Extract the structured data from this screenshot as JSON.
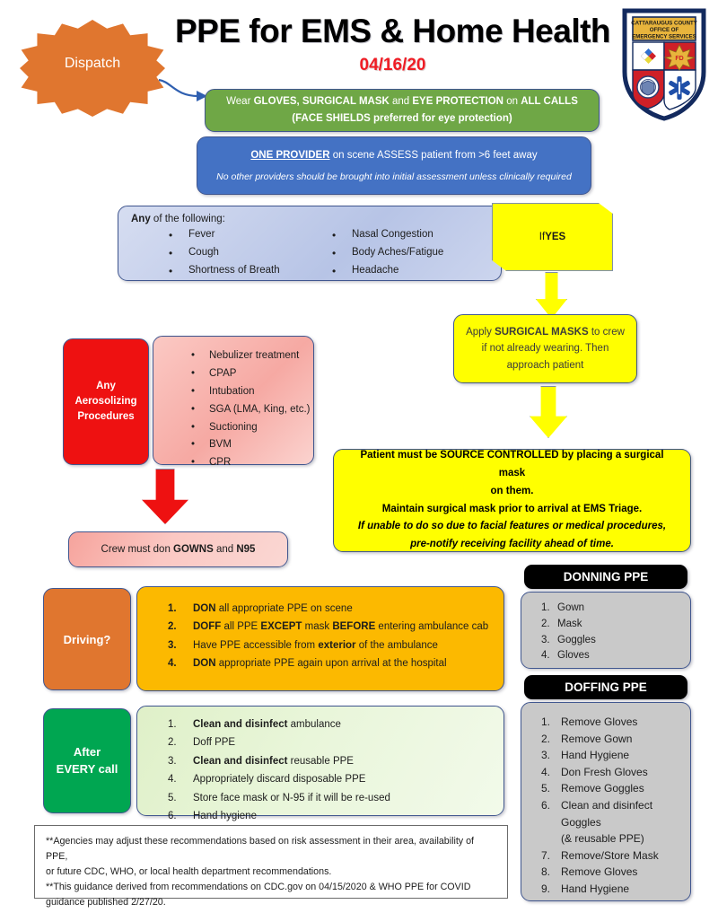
{
  "header": {
    "title": "PPE for EMS & Home Health",
    "date": "04/16/20",
    "badge": {
      "line1": "CATTARAUGUS COUNTY",
      "line2": "OFFICE OF",
      "line3": "EMERGENCY SERVICES"
    }
  },
  "colors": {
    "dispatch_orange": "#E0762F",
    "green": "#6FA746",
    "blue": "#4472C4",
    "yellow": "#FFFF00",
    "red": "#EE1111",
    "amber": "#FCB900",
    "green_solid": "#00A651",
    "grey": "#C9C9C9",
    "date_red": "#EF1C24"
  },
  "dispatch": {
    "label": "Dispatch"
  },
  "all_calls": {
    "line1_a": "Wear ",
    "line1_b": "GLOVES, SURGICAL MASK",
    "line1_c": " and ",
    "line1_d": "EYE PROTECTION",
    "line1_e": " on ",
    "line1_f": "ALL CALLS",
    "line2": "(FACE SHIELDS preferred for eye protection)"
  },
  "one_provider": {
    "line1_bold": "ONE PROVIDER",
    "line1_rest": " on scene ASSESS patient from >6 feet away",
    "line2": "No other providers should be brought into initial assessment unless clinically required"
  },
  "symptoms": {
    "heading_bold": "Any",
    "heading_rest": " of the following:",
    "left": [
      "Fever",
      "Cough",
      "Shortness of Breath"
    ],
    "right": [
      "Nasal Congestion",
      "Body Aches/Fatigue",
      "Headache"
    ]
  },
  "if_yes": {
    "prefix": "If ",
    "bold": "YES"
  },
  "apply_masks": {
    "line1_a": "Apply ",
    "line1_b": "SURGICAL MASKS",
    "line1_c": " to crew",
    "line2": "if not already wearing. Then",
    "line3": "approach patient"
  },
  "source_control": {
    "line1": "Patient must be SOURCE CONTROLLED by placing a surgical mask",
    "line2": "on them.",
    "line3": "Maintain surgical mask prior to arrival at EMS Triage.",
    "line4": "If unable to do so due to facial features or medical procedures,",
    "line5": "pre-notify receiving facility ahead of time."
  },
  "aerosolizing": {
    "label_line1": "Any",
    "label_line2": "Aerosolizing",
    "label_line3": "Procedures",
    "items": [
      "Nebulizer treatment",
      "CPAP",
      "Intubation",
      "SGA (LMA, King, etc.)",
      "Suctioning",
      "BVM",
      "CPR"
    ]
  },
  "gowns": {
    "a": "Crew must don ",
    "b": "GOWNS",
    "c": " and ",
    "d": "N95"
  },
  "driving": {
    "label": "Driving?",
    "items": [
      {
        "n": "1.",
        "parts": [
          {
            "t": "DON",
            "b": true
          },
          {
            "t": " all appropriate PPE on scene",
            "b": false
          }
        ]
      },
      {
        "n": "2.",
        "parts": [
          {
            "t": "DOFF",
            "b": true
          },
          {
            "t": " all PPE ",
            "b": false
          },
          {
            "t": "EXCEPT",
            "b": true
          },
          {
            "t": " mask ",
            "b": false
          },
          {
            "t": "BEFORE",
            "b": true
          },
          {
            "t": " entering ambulance cab",
            "b": false
          }
        ]
      },
      {
        "n": "3.",
        "parts": [
          {
            "t": "Have PPE accessible from ",
            "b": false
          },
          {
            "t": "exterior",
            "b": true
          },
          {
            "t": " of the ambulance",
            "b": false
          }
        ]
      },
      {
        "n": "4.",
        "parts": [
          {
            "t": "DON",
            "b": true
          },
          {
            "t": " appropriate PPE again upon arrival at the hospital",
            "b": false
          }
        ]
      }
    ]
  },
  "after_every_call": {
    "label_line1": "After",
    "label_line2": "EVERY call",
    "items": [
      {
        "n": "1.",
        "parts": [
          {
            "t": "Clean and disinfect",
            "b": true
          },
          {
            "t": " ambulance",
            "b": false
          }
        ]
      },
      {
        "n": "2.",
        "parts": [
          {
            "t": "Doff PPE",
            "b": false
          }
        ]
      },
      {
        "n": "3.",
        "parts": [
          {
            "t": "Clean and disinfect",
            "b": true
          },
          {
            "t": " reusable PPE",
            "b": false
          }
        ]
      },
      {
        "n": "4.",
        "parts": [
          {
            "t": "Appropriately discard disposable PPE",
            "b": false
          }
        ]
      },
      {
        "n": "5.",
        "parts": [
          {
            "t": "Store face mask or N-95 if it will be re-used",
            "b": false
          }
        ]
      },
      {
        "n": "6.",
        "parts": [
          {
            "t": "Hand hygiene",
            "b": false
          }
        ]
      }
    ]
  },
  "donning": {
    "title": "DONNING PPE",
    "items": [
      {
        "n": "1.",
        "t": "Gown"
      },
      {
        "n": "2.",
        "t": "Mask"
      },
      {
        "n": "3.",
        "t": "Goggles"
      },
      {
        "n": "4.",
        "t": "Gloves"
      }
    ]
  },
  "doffing": {
    "title": "DOFFING PPE",
    "items": [
      {
        "n": "1.",
        "t": "Remove Gloves"
      },
      {
        "n": "2.",
        "t": "Remove Gown"
      },
      {
        "n": "3.",
        "t": "Hand Hygiene"
      },
      {
        "n": "4.",
        "t": "Don Fresh Gloves"
      },
      {
        "n": "5.",
        "t": "Remove Goggles"
      },
      {
        "n": "6.",
        "t": "Clean and disinfect"
      }
    ],
    "item6_cont1": "Goggles",
    "item6_cont2": "(& reusable PPE)",
    "items_tail": [
      {
        "n": "7.",
        "t": "Remove/Store Mask"
      },
      {
        "n": "8.",
        "t": "Remove Gloves"
      },
      {
        "n": "9.",
        "t": "Hand Hygiene"
      }
    ]
  },
  "footer": {
    "line1": "**Agencies may adjust these recommendations based on risk assessment in their area, availability of PPE,",
    "line2": "or future CDC, WHO, or local health department recommendations.",
    "line3": "**This guidance derived from recommendations on CDC.gov on 04/15/2020 & WHO PPE for COVID",
    "line4": "guidance published 2/27/20."
  }
}
